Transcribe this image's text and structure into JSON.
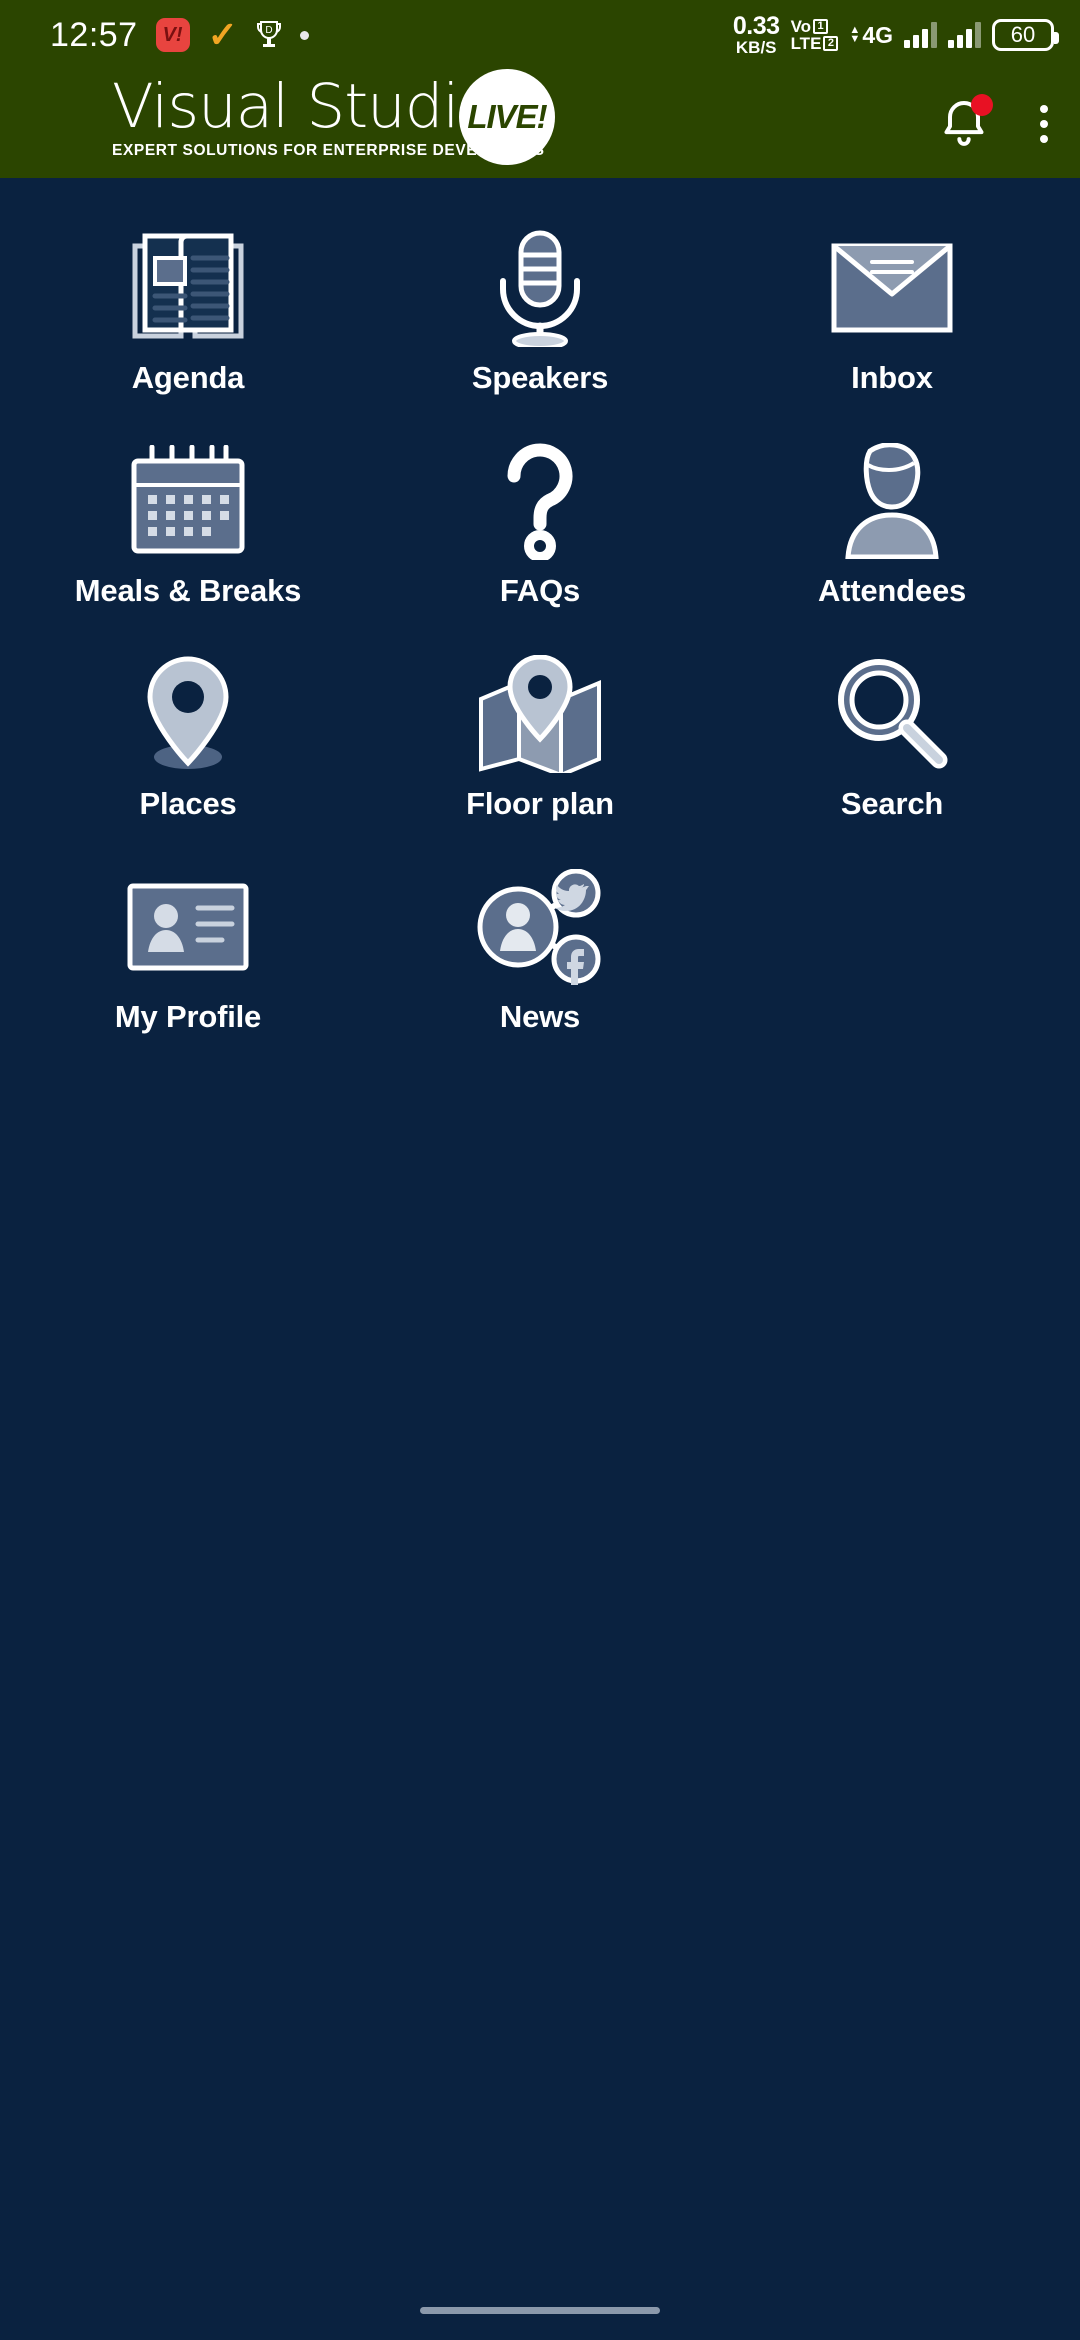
{
  "status_bar": {
    "time": "12:57",
    "app_icon_label": "V!",
    "check_icon": "check-icon",
    "trophy_icon": "trophy-icon",
    "dot_icon": "dot-icon",
    "data_rate_value": "0.33",
    "data_rate_unit": "KB/S",
    "volte_line1": "Vo",
    "volte_line2": "LTE",
    "sim1": "1",
    "sim2": "2",
    "network_type": "4G",
    "battery_percent": "60"
  },
  "header": {
    "brand_name": "Visual Studio",
    "brand_trademark": "®",
    "live_badge": "LIVE!",
    "tagline": "EXPERT SOLUTIONS FOR ENTERPRISE DEVELOPERS",
    "bell_icon": "notification-bell-icon",
    "has_notification": true,
    "overflow_icon": "overflow-menu-icon",
    "background_color": "#2b4500"
  },
  "theme": {
    "body_background": "#0a2240",
    "icon_fill": "#5b6e8c",
    "icon_stroke": "#ffffff",
    "accent_red": "#e81123"
  },
  "grid": {
    "items": [
      {
        "label": "Agenda",
        "icon": "open-book-icon"
      },
      {
        "label": "Speakers",
        "icon": "microphone-icon"
      },
      {
        "label": "Inbox",
        "icon": "envelope-icon"
      },
      {
        "label": "Meals & Breaks",
        "icon": "calendar-icon"
      },
      {
        "label": "FAQs",
        "icon": "question-mark-icon"
      },
      {
        "label": "Attendees",
        "icon": "person-bust-icon"
      },
      {
        "label": "Places",
        "icon": "map-pin-icon"
      },
      {
        "label": "Floor plan",
        "icon": "folded-map-icon"
      },
      {
        "label": "Search",
        "icon": "magnifier-icon"
      },
      {
        "label": "My Profile",
        "icon": "id-card-icon"
      },
      {
        "label": "News",
        "icon": "social-share-icon"
      }
    ]
  },
  "navigation_bar": {
    "gesture_pill": "home-indicator"
  }
}
